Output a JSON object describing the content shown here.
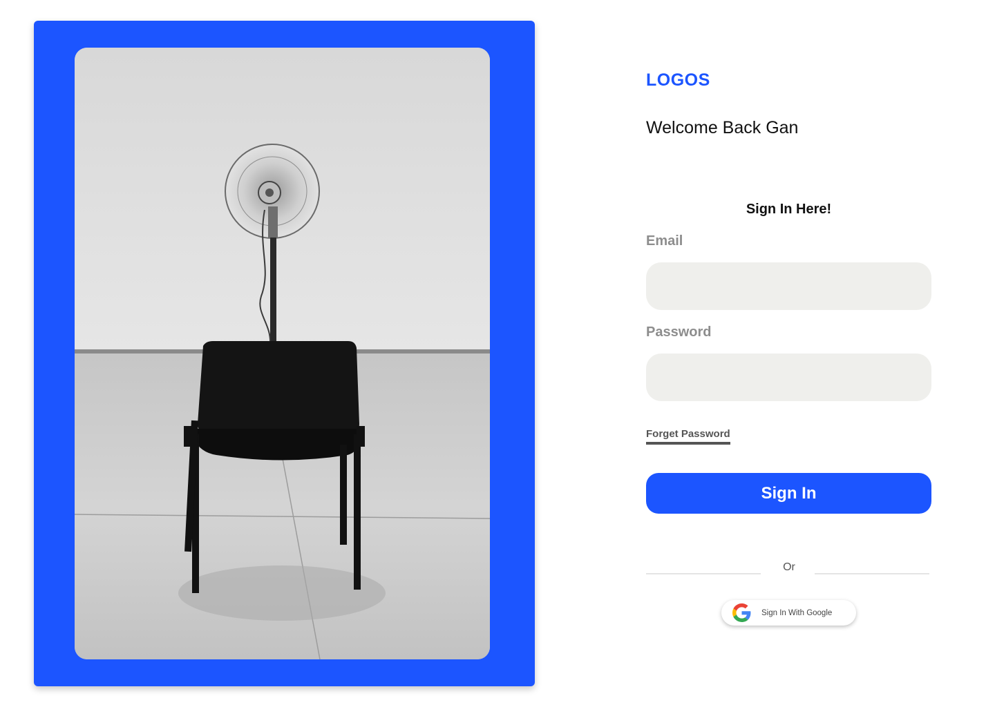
{
  "hero": {
    "panel_color": "#1c55ff",
    "photo_description_icon": "chair-with-fan-photo"
  },
  "brand": {
    "logo": "LOGOS",
    "color": "#1c55ff"
  },
  "welcome": {
    "text": "Welcome Back Gan"
  },
  "form": {
    "heading": "Sign In Here!",
    "email_label": "Email",
    "email_value": "",
    "email_placeholder": "",
    "password_label": "Password",
    "password_value": "",
    "password_placeholder": "",
    "forgot_label": "Forget Password",
    "submit_label": "Sign In",
    "divider_text": "Or",
    "google_label": "Sign In With Google",
    "google_icon": "google-g-icon"
  },
  "colors": {
    "accent": "#1c55ff",
    "input_bg": "#efefec",
    "label_gray": "#8d8d8d"
  }
}
